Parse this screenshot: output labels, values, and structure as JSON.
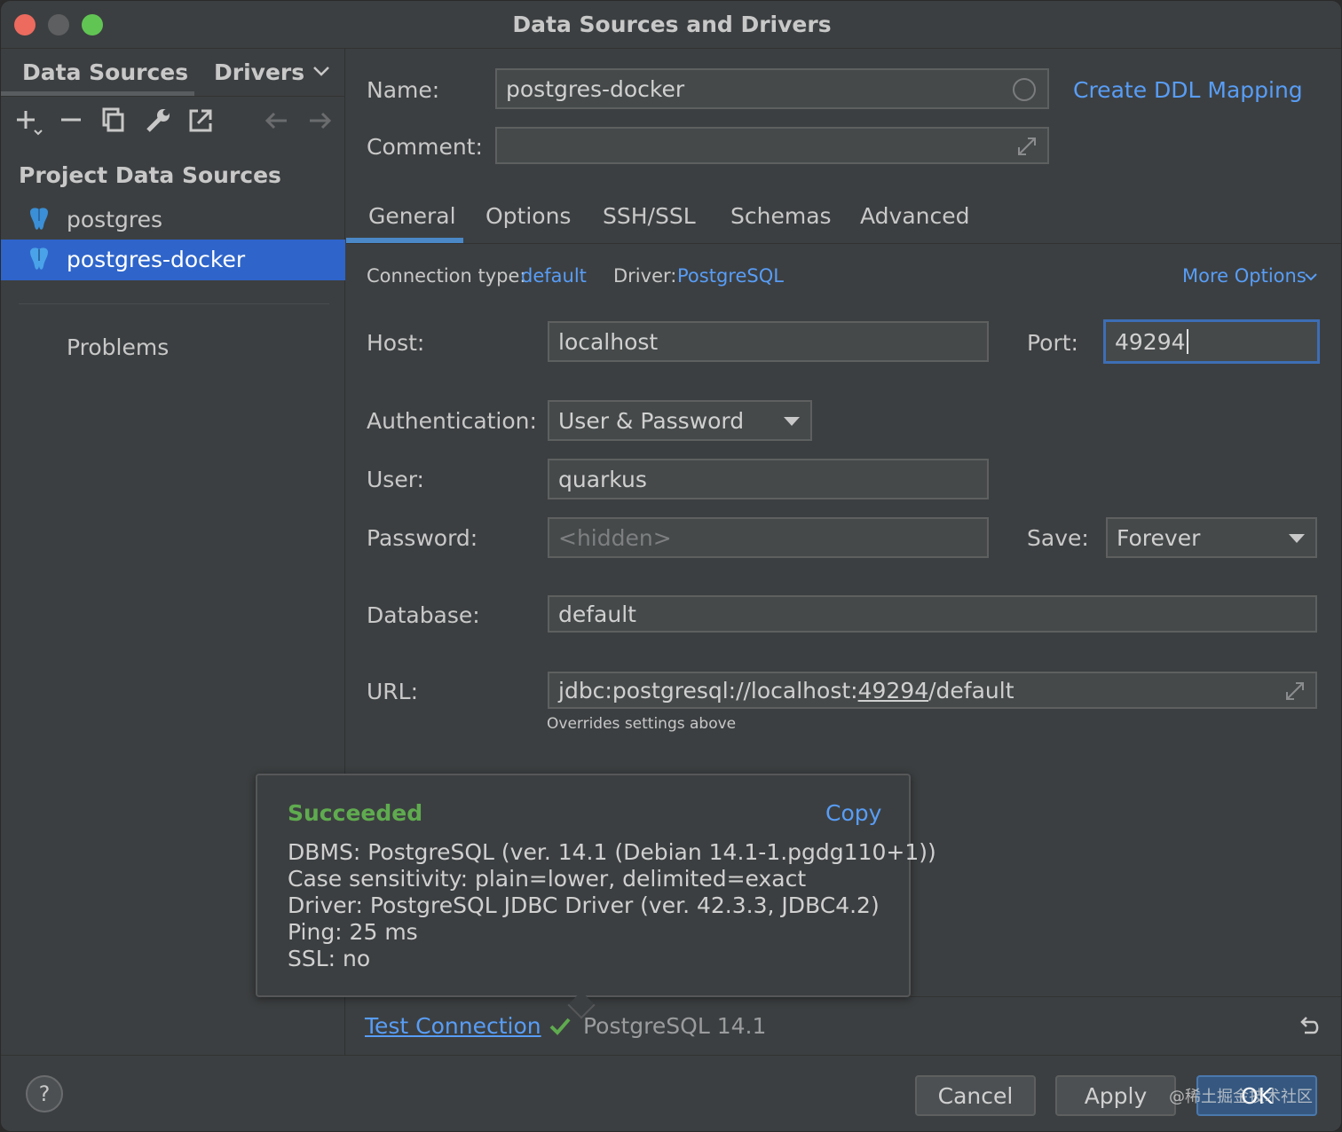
{
  "window": {
    "title": "Data Sources and Drivers"
  },
  "sidebar": {
    "tabs": [
      "Data Sources",
      "Drivers"
    ],
    "section_title": "Project Data Sources",
    "items": [
      {
        "label": "postgres",
        "selected": false
      },
      {
        "label": "postgres-docker",
        "selected": true
      }
    ],
    "problems_label": "Problems"
  },
  "form": {
    "name_label": "Name:",
    "name_value": "postgres-docker",
    "create_ddl_link": "Create DDL Mapping",
    "comment_label": "Comment:",
    "comment_value": ""
  },
  "tabs": [
    "General",
    "Options",
    "SSH/SSL",
    "Schemas",
    "Advanced"
  ],
  "general": {
    "connection_type_label": "Connection type:",
    "connection_type_value": "default",
    "driver_label": "Driver:",
    "driver_value": "PostgreSQL",
    "more_options": "More Options",
    "host_label": "Host:",
    "host_value": "localhost",
    "port_label": "Port:",
    "port_value": "49294",
    "auth_label": "Authentication:",
    "auth_value": "User & Password",
    "user_label": "User:",
    "user_value": "quarkus",
    "password_label": "Password:",
    "password_placeholder": "<hidden>",
    "save_label": "Save:",
    "save_value": "Forever",
    "database_label": "Database:",
    "database_value": "default",
    "url_label": "URL:",
    "url_prefix": "jdbc:postgresql://localhost:",
    "url_port": "49294",
    "url_suffix": "/default",
    "url_hint": "Overrides settings above"
  },
  "popup": {
    "status": "Succeeded",
    "copy": "Copy",
    "lines": [
      "DBMS: PostgreSQL (ver. 14.1 (Debian 14.1-1.pgdg110+1))",
      "Case sensitivity: plain=lower, delimited=exact",
      "Driver: PostgreSQL JDBC Driver (ver. 42.3.3, JDBC4.2)",
      "Ping: 25 ms",
      "SSL: no"
    ]
  },
  "test": {
    "link": "Test Connection",
    "result": "PostgreSQL 14.1"
  },
  "footer": {
    "help": "?",
    "cancel": "Cancel",
    "apply": "Apply",
    "ok": "OK",
    "watermark": "@稀土掘金技术社区"
  },
  "colors": {
    "accent": "#589df6",
    "selection": "#2f65ca",
    "success": "#5fab4f"
  }
}
